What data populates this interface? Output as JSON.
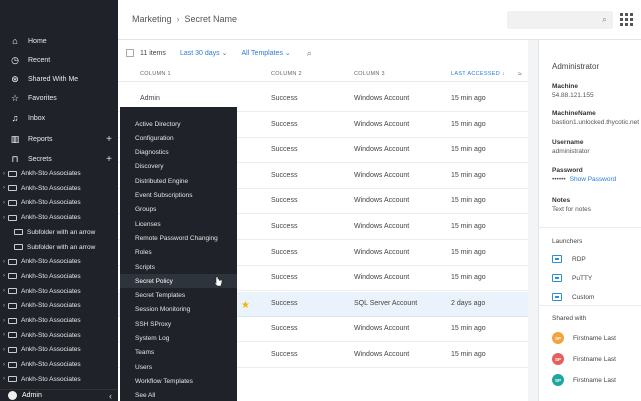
{
  "sidebar": {
    "nav": [
      {
        "label": "Home",
        "icon": "home-icon",
        "glyph": "⌂"
      },
      {
        "label": "Recent",
        "icon": "clock-icon",
        "glyph": "◷"
      },
      {
        "label": "Shared With Me",
        "icon": "shared-icon",
        "glyph": "⊛"
      },
      {
        "label": "Favorites",
        "icon": "star-icon",
        "glyph": "☆"
      },
      {
        "label": "Inbox",
        "icon": "bell-icon",
        "glyph": "♫"
      },
      {
        "label": "Reports",
        "icon": "bar-chart-icon",
        "glyph": "▥"
      },
      {
        "label": "Secrets",
        "icon": "lock-icon",
        "glyph": "⊓"
      }
    ],
    "plus": "+",
    "folders": [
      {
        "label": "Ankh-Sto Associates",
        "sub": false
      },
      {
        "label": "Ankh-Sto Associates",
        "sub": false
      },
      {
        "label": "Ankh-Sto Associates",
        "sub": false
      },
      {
        "label": "Ankh-Sto Associates",
        "sub": false
      },
      {
        "label": "Subfolder with an arrow",
        "sub": true
      },
      {
        "label": "Subfolder with an arrow",
        "sub": true
      },
      {
        "label": "Ankh-Sto Associates",
        "sub": false
      },
      {
        "label": "Ankh-Sto Associates",
        "sub": false
      },
      {
        "label": "Ankh-Sto Associates",
        "sub": false
      },
      {
        "label": "Ankh-Sto Associates",
        "sub": false
      },
      {
        "label": "Ankh-Sto Associates",
        "sub": false
      },
      {
        "label": "Ankh-Sto Associates",
        "sub": false
      },
      {
        "label": "Ankh-Sto Associates",
        "sub": false
      },
      {
        "label": "Ankh-Sto Associates",
        "sub": false
      },
      {
        "label": "Ankh-Sto Associates",
        "sub": false
      },
      {
        "label": "Ankh-Sto Associates",
        "sub": false
      }
    ],
    "user": "Admin",
    "collapse": "‹"
  },
  "header": {
    "crumb1": "Marketing",
    "crumb_sep": "›",
    "crumb2": "Secret Name"
  },
  "toolbar": {
    "count": "11 items",
    "date_filter": "Last 30 days ⌄",
    "template_filter": "All Templates ⌄"
  },
  "table": {
    "columns": [
      "COLUMN 1",
      "COLUMN 2",
      "COLUMN 3",
      "LAST ACCESSED ↓"
    ],
    "rows": [
      {
        "c1": "Admin",
        "c2": "Success",
        "c3": "Windows Account",
        "c4": "15 min ago",
        "selected": false
      },
      {
        "c1": "",
        "c2": "Success",
        "c3": "Windows Account",
        "c4": "15 min ago",
        "selected": false
      },
      {
        "c1": "",
        "c2": "Success",
        "c3": "Windows Account",
        "c4": "15 min ago",
        "selected": false
      },
      {
        "c1": "",
        "c2": "Success",
        "c3": "Windows Account",
        "c4": "15 min ago",
        "selected": false
      },
      {
        "c1": "",
        "c2": "Success",
        "c3": "Windows Account",
        "c4": "15 min ago",
        "selected": false
      },
      {
        "c1": "",
        "c2": "Success",
        "c3": "Windows Account",
        "c4": "15 min ago",
        "selected": false
      },
      {
        "c1": "",
        "c2": "Success",
        "c3": "Windows Account",
        "c4": "15 min ago",
        "selected": false
      },
      {
        "c1": "",
        "c2": "Success",
        "c3": "Windows Account",
        "c4": "15 min ago",
        "selected": false
      },
      {
        "c1": "",
        "c2": "Success",
        "c3": "SQL Server Account",
        "c4": "2 days ago",
        "selected": true
      },
      {
        "c1": "",
        "c2": "Success",
        "c3": "Windows Account",
        "c4": "15 min ago",
        "selected": false
      },
      {
        "c1": "",
        "c2": "Success",
        "c3": "Windows Account",
        "c4": "15 min ago",
        "selected": false
      }
    ]
  },
  "menu": {
    "items": [
      "Active Directory",
      "Configuration",
      "Diagnostics",
      "Discovery",
      "Distributed Engine",
      "Event Subscriptions",
      "Groups",
      "Licenses",
      "Remote Password Changing",
      "Roles",
      "Scripts",
      "Secret Policy",
      "Secret Templates",
      "Session Monitoring",
      "SSH SProxy",
      "System Log",
      "Teams",
      "Users",
      "Workflow Templates",
      "See All"
    ],
    "hover_index": 11
  },
  "detail": {
    "title": "Administrator",
    "fields": [
      {
        "label": "Machine",
        "value": "54.88.121.155"
      },
      {
        "label": "MachineName",
        "value": "bastion1.unlocked.thycotic.net"
      },
      {
        "label": "Username",
        "value": "administrator"
      },
      {
        "label": "Password",
        "value": "••••••",
        "link": "Show Password"
      },
      {
        "label": "Notes",
        "value": "Text for notes"
      }
    ],
    "launchers_title": "Launchers",
    "launchers": [
      "RDP",
      "PuTTY",
      "Custom"
    ],
    "shared_title": "Shared with",
    "shared": [
      {
        "initials": "SP",
        "name": "Firstname Last",
        "color": "#f2a33a"
      },
      {
        "initials": "SP",
        "name": "Firstname Last",
        "color": "#e5605c"
      },
      {
        "initials": "SP",
        "name": "Firstname Last",
        "color": "#1ea7a0"
      }
    ]
  },
  "colors": {
    "accent": "#2b7bd6",
    "sidebar": "#1f2329",
    "star": "#f4b400"
  }
}
